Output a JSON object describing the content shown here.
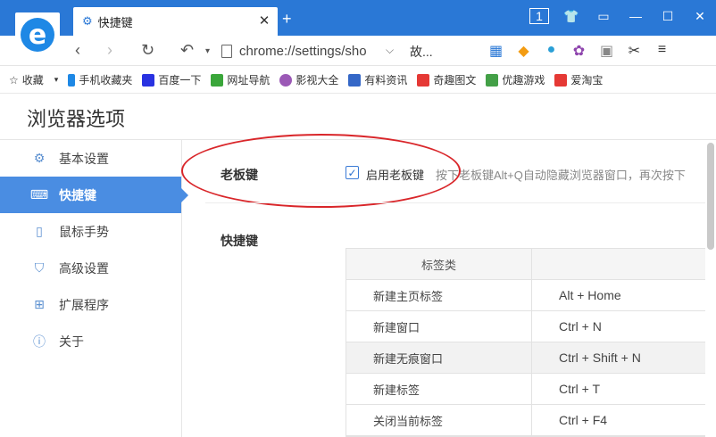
{
  "tab": {
    "title": "快捷键"
  },
  "window": {
    "badge": "1"
  },
  "toolbar": {
    "url": "chrome://settings/sho",
    "extra": "故..."
  },
  "bookmarks": [
    {
      "label": "收藏",
      "icon": "star-icon"
    },
    {
      "label": "手机收藏夹",
      "icon": "phone-icon"
    },
    {
      "label": "百度一下",
      "icon": "baidu-paw-icon"
    },
    {
      "label": "网址导航",
      "icon": "hao-icon"
    },
    {
      "label": "影视大全",
      "icon": "video-icon"
    },
    {
      "label": "有料资讯",
      "icon": "news-icon"
    },
    {
      "label": "奇趣图文",
      "icon": "qu-icon"
    },
    {
      "label": "优趣游戏",
      "icon": "game-icon"
    },
    {
      "label": "爱淘宝",
      "icon": "taobao-icon"
    }
  ],
  "settings": {
    "title": "浏览器选项"
  },
  "sidebar": {
    "items": [
      {
        "label": "基本设置",
        "icon": "gear-icon",
        "active": false
      },
      {
        "label": "快捷键",
        "icon": "keyboard-icon",
        "active": true
      },
      {
        "label": "鼠标手势",
        "icon": "mouse-icon",
        "active": false
      },
      {
        "label": "高级设置",
        "icon": "shield-settings-icon",
        "active": false
      },
      {
        "label": "扩展程序",
        "icon": "extensions-icon",
        "active": false
      },
      {
        "label": "关于",
        "icon": "info-icon",
        "active": false
      }
    ]
  },
  "boss_key": {
    "label": "老板键",
    "checked": true,
    "enable_label": "启用老板键",
    "description": "按下老板键Alt+Q自动隐藏浏览器窗口，再次按下"
  },
  "shortcuts": {
    "label": "快捷键",
    "header": [
      "标签类",
      ""
    ],
    "rows": [
      {
        "action": "新建主页标签",
        "keys": "Alt + Home"
      },
      {
        "action": "新建窗口",
        "keys": "Ctrl + N"
      },
      {
        "action": "新建无痕窗口",
        "keys": "Ctrl + Shift + N"
      },
      {
        "action": "新建标签",
        "keys": "Ctrl + T"
      },
      {
        "action": "关闭当前标签",
        "keys": "Ctrl + F4"
      }
    ]
  }
}
